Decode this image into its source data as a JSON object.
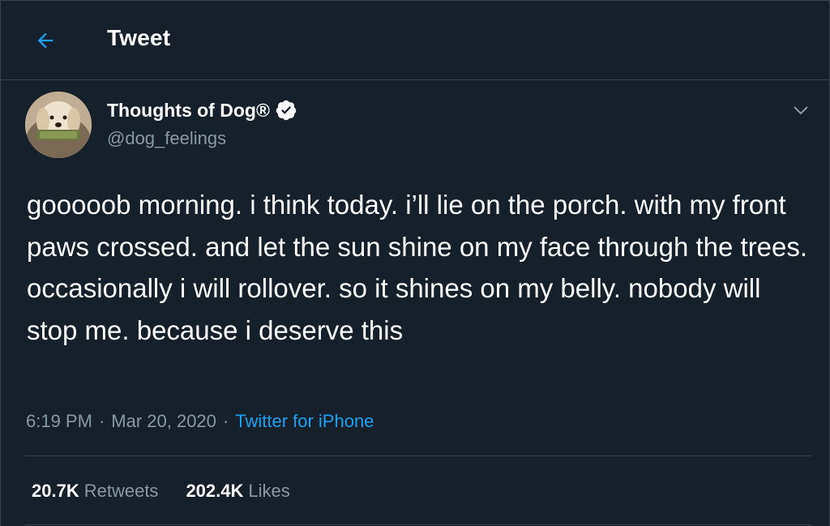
{
  "header": {
    "title": "Tweet",
    "back_icon": "arrow-left-icon"
  },
  "author": {
    "display_name": "Thoughts of Dog®",
    "handle": "@dog_feelings",
    "verified_icon": "verified-badge-icon",
    "menu_icon": "chevron-down-icon"
  },
  "tweet": {
    "text": "gooooob morning. i think today. i’ll lie on the porch. with my front paws crossed. and let the sun shine on my face through the trees. occasionally i will rollover. so it shines on my belly. nobody will stop me. because i deserve this",
    "time": "6:19 PM",
    "separator": "·",
    "date": "Mar 20, 2020",
    "source": "Twitter for iPhone"
  },
  "stats": {
    "retweets_count": "20.7K",
    "retweets_label": "Retweets",
    "likes_count": "202.4K",
    "likes_label": "Likes"
  },
  "colors": {
    "background": "#15202b",
    "accent": "#1da1f2",
    "secondary_text": "#8899a6",
    "border": "#38444d"
  }
}
